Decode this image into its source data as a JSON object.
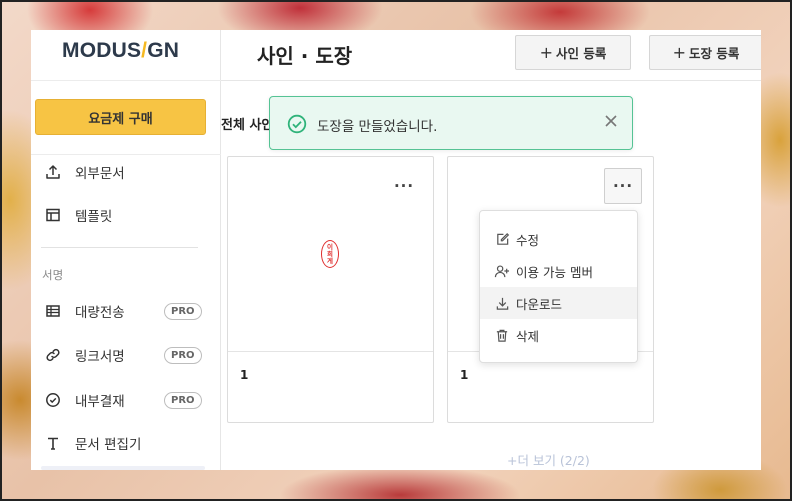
{
  "brand": {
    "logo_part1": "MODUS",
    "logo_slash": "/",
    "logo_part2": "GN"
  },
  "sidebar": {
    "buy_button": "요금제 구매",
    "items_top": [
      {
        "label": "외부문서",
        "icon": "upload-icon"
      },
      {
        "label": "템플릿",
        "icon": "template-icon"
      }
    ],
    "section_label": "서명",
    "items_sign": [
      {
        "label": "대량전송",
        "icon": "table-icon",
        "badge": "PRO"
      },
      {
        "label": "링크서명",
        "icon": "link-icon",
        "badge": "PRO"
      },
      {
        "label": "내부결재",
        "icon": "check-circle-icon",
        "badge": "PRO"
      },
      {
        "label": "문서 편집기",
        "icon": "text-icon"
      }
    ]
  },
  "header": {
    "title": "사인 · 도장",
    "add_sign_button": "사인 등록",
    "add_stamp_button": "도장 등록",
    "plus": "+"
  },
  "filter": {
    "label": "전체 사인"
  },
  "cards": [
    {
      "name": "1",
      "more": "···",
      "seal_text": [
        "이",
        "희",
        "게"
      ]
    },
    {
      "name": "1",
      "more": "···"
    }
  ],
  "context_menu": {
    "items": [
      {
        "label": "수정",
        "icon": "edit-icon"
      },
      {
        "label": "이용 가능 멤버",
        "icon": "add-user-icon"
      },
      {
        "label": "다운로드",
        "icon": "download-icon"
      },
      {
        "label": "삭제",
        "icon": "trash-icon"
      }
    ]
  },
  "more_link": "+더 보기 (2/2)",
  "toast": {
    "message": "도장을 만들었습니다.",
    "icon": "check-circle-icon"
  },
  "colors": {
    "accent": "#f7c444",
    "toast_border": "#55c394",
    "toast_bg": "#e9f8f1",
    "seal": "#e03030"
  }
}
